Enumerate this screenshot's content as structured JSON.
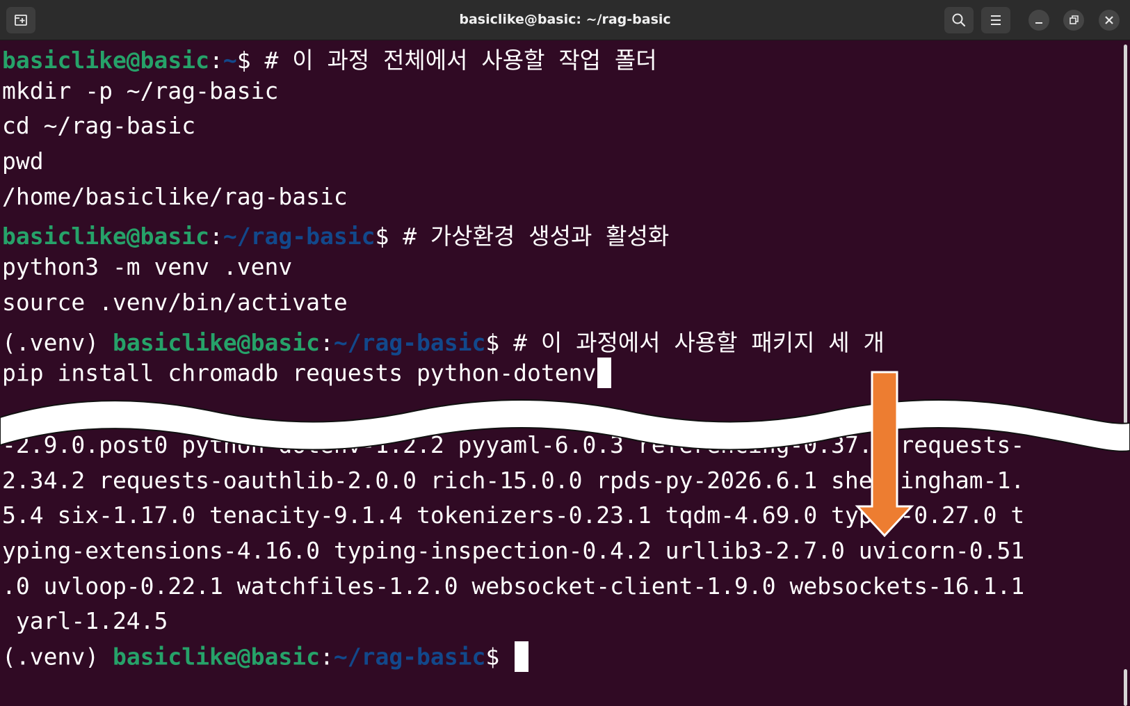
{
  "window": {
    "title": "basiclike@basic: ~/rag-basic"
  },
  "toolbar": {
    "new_tab_icon": "new-tab-icon",
    "search_icon": "search-icon",
    "menu_icon": "hamburger-menu-icon",
    "minimize_icon": "minimize-icon",
    "restore_icon": "restore-icon",
    "close_icon": "close-icon"
  },
  "terminal": {
    "prompt_user": "basiclike@basic",
    "home_path": "~",
    "project_path": "~/rag-basic",
    "venv_tag": "(.venv) ",
    "comment_workdir": "# 이 과정 전체에서 사용할 작업 폴더",
    "cmd_mkdir": "mkdir -p ~/rag-basic",
    "cmd_cd": "cd ~/rag-basic",
    "cmd_pwd": "pwd",
    "out_pwd": "/home/basiclike/rag-basic",
    "comment_venv": "# 가상환경 생성과 활성화",
    "cmd_venv": "python3 -m venv .venv",
    "cmd_activate": "source .venv/bin/activate",
    "comment_packages": "# 이 과정에서 사용할 패키지 세 개",
    "cmd_pip": "pip install chromadb requests python-dotenv",
    "install_output": [
      "-2.9.0.post0 python-dotenv-1.2.2 pyyaml-6.0.3 referencing-0.37.0 requests-",
      "2.34.2 requests-oauthlib-2.0.0 rich-15.0.0 rpds-py-2026.6.1 shellingham-1.",
      "5.4 six-1.17.0 tenacity-9.1.4 tokenizers-0.23.1 tqdm-4.69.0 typer-0.27.0 t",
      "yping-extensions-4.16.0 typing-inspection-0.4.2 urllib3-2.7.0 uvicorn-0.51",
      ".0 uvloop-0.22.1 watchfiles-1.2.0 websocket-client-1.9.0 websockets-16.1.1",
      " yarl-1.24.5"
    ]
  },
  "annotation": {
    "arrow_color": "#ed7d31",
    "arrow_direction": "down"
  }
}
